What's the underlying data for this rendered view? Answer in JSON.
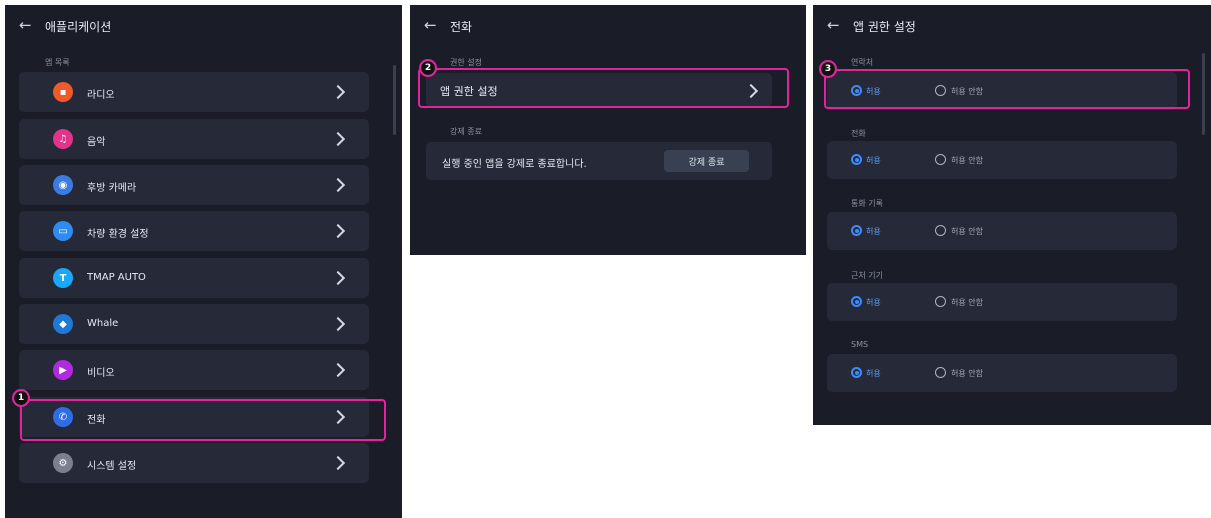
{
  "panel1": {
    "title": "애플리케이션",
    "section": "앱 목록",
    "items": [
      {
        "label": "라디오",
        "icon_color": "#ef5a2a"
      },
      {
        "label": "음악",
        "icon_color": "#e2358a"
      },
      {
        "label": "후방 카메라",
        "icon_color": "#3b7ce0"
      },
      {
        "label": "차량 환경 설정",
        "icon_color": "#2e8cf0"
      },
      {
        "label": "TMAP AUTO",
        "icon_color": "#1aa8ff",
        "icon_glyph": "T"
      },
      {
        "label": "Whale",
        "icon_color": "#1f78d6"
      },
      {
        "label": "비디오",
        "icon_color": "#b02ae0"
      },
      {
        "label": "전화",
        "icon_color": "#2f6ce8"
      },
      {
        "label": "시스템 설정",
        "icon_color": "#7a8090"
      }
    ],
    "badge": "1"
  },
  "panel2": {
    "title": "전화",
    "section1": "권한 설정",
    "app_permission_label": "앱 권한 설정",
    "section2": "강제 종료",
    "force_stop_desc": "실행 중인 앱을 강제로 종료합니다.",
    "force_stop_button": "강제 종료",
    "badge": "2"
  },
  "panel3": {
    "title": "앱 권한 설정",
    "groups": [
      {
        "section": "연락처",
        "allow": "허용",
        "deny": "허용 안함"
      },
      {
        "section": "전화",
        "allow": "허용",
        "deny": "허용 안함"
      },
      {
        "section": "통화 기록",
        "allow": "허용",
        "deny": "허용 안함"
      },
      {
        "section": "근처 기기",
        "allow": "허용",
        "deny": "허용 안함"
      },
      {
        "section": "SMS",
        "allow": "허용",
        "deny": "허용 안함"
      }
    ],
    "badge": "3"
  },
  "colors": {
    "panel_bg": "#1a1d28",
    "row_bg": "#252938",
    "highlight": "#e4229d",
    "radio_on": "#3d8bff"
  }
}
